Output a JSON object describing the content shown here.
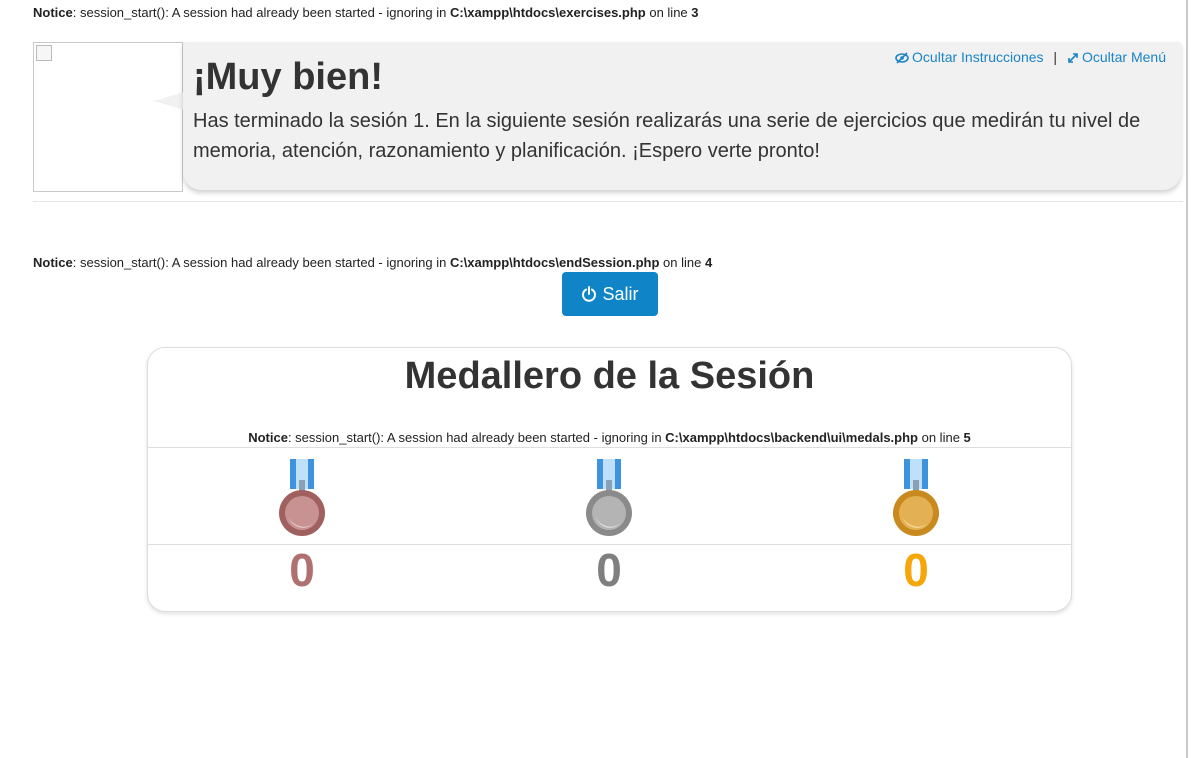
{
  "notices": [
    {
      "prefix": "Notice",
      "message": ": session_start(): A session had already been started - ignoring in ",
      "file": "C:\\xampp\\htdocs\\exercises.php",
      "on_line": " on line ",
      "line": "3"
    },
    {
      "prefix": "Notice",
      "message": ": session_start(): A session had already been started - ignoring in ",
      "file": "C:\\xampp\\htdocs\\endSession.php",
      "on_line": " on line ",
      "line": "4"
    },
    {
      "prefix": "Notice",
      "message": ": session_start(): A session had already been started - ignoring in ",
      "file": "C:\\xampp\\htdocs\\backend\\ui\\medals.php",
      "on_line": " on line ",
      "line": "5"
    }
  ],
  "bubble": {
    "title": "¡Muy bien!",
    "message": "Has terminado la sesión 1. En la siguiente sesión realizarás una serie de ejercicios que medirán tu nivel de memoria, atención, razonamiento y planificación. ¡Espero verte pronto!",
    "hide_instructions": "Ocultar Instrucciones",
    "separator": "|",
    "hide_menu": "Ocultar Menú"
  },
  "exit_button": {
    "label": "Salir"
  },
  "medals": {
    "title": "Medallero de la Sesión",
    "items": [
      {
        "kind": "bronze",
        "count": "0",
        "color": "#b0706f"
      },
      {
        "kind": "silver",
        "count": "0",
        "color": "#7f7f7f"
      },
      {
        "kind": "gold",
        "count": "0",
        "color": "#f5a60a"
      }
    ]
  },
  "colors": {
    "accent": "#0f85c8",
    "link": "#1a84c7"
  }
}
